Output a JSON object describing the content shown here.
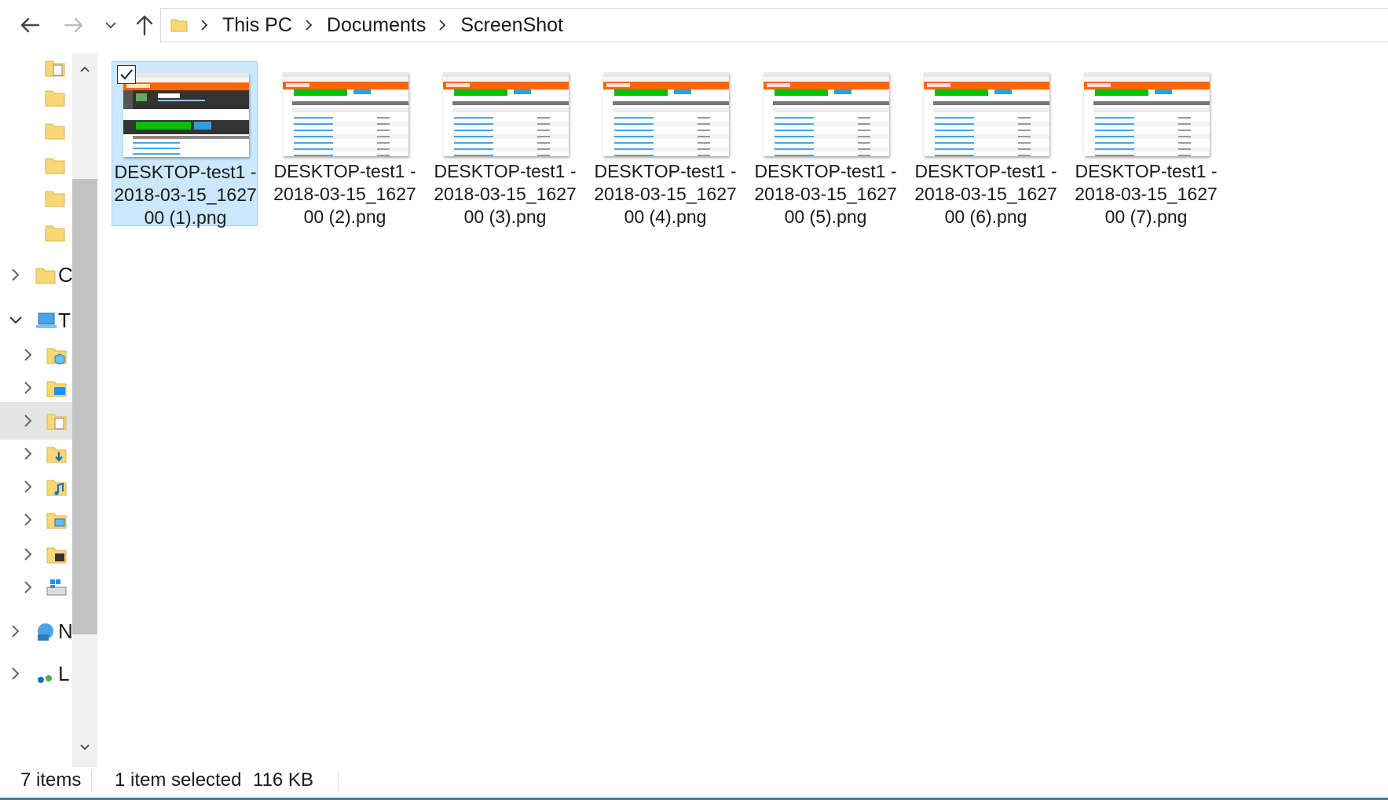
{
  "breadcrumb": [
    "This PC",
    "Documents",
    "ScreenShot"
  ],
  "nav_buttons": {
    "back": "arrow-left-icon",
    "forward": "arrow-right-icon",
    "recent": "chevron-down-icon",
    "up": "arrow-up-icon"
  },
  "nav_pane": {
    "items": [
      {
        "label": "",
        "icon": "folder-documents-icon"
      },
      {
        "label": "",
        "icon": "folder-pictures-icon"
      },
      {
        "label": "",
        "icon": "folder-icon"
      },
      {
        "label": "",
        "icon": "folder-icon"
      },
      {
        "label": "",
        "icon": "folder-icon"
      },
      {
        "label": "",
        "icon": "folder-icon"
      },
      {
        "label": "C",
        "icon": "folder-icon"
      },
      {
        "label": "T",
        "icon": "this-pc-icon"
      },
      {
        "label": "",
        "icon": "3d-objects-icon"
      },
      {
        "label": "",
        "icon": "desktop-folder-icon"
      },
      {
        "label": "",
        "icon": "documents-folder-icon"
      },
      {
        "label": "",
        "icon": "downloads-folder-icon"
      },
      {
        "label": "",
        "icon": "music-folder-icon"
      },
      {
        "label": "",
        "icon": "pictures-folder-icon"
      },
      {
        "label": "",
        "icon": "videos-folder-icon"
      },
      {
        "label": "",
        "icon": "windows-drive-icon"
      },
      {
        "label": "N",
        "icon": "network-icon"
      },
      {
        "label": "L",
        "icon": "homegroup-icon"
      }
    ]
  },
  "files": [
    {
      "name": "DESKTOP-test1 - 2018-03-15_162700 (1).png",
      "selected": true,
      "thumb_variant": "page"
    },
    {
      "name": "DESKTOP-test1 - 2018-03-15_162700 (2).png",
      "selected": false,
      "thumb_variant": "files"
    },
    {
      "name": "DESKTOP-test1 - 2018-03-15_162700 (3).png",
      "selected": false,
      "thumb_variant": "files"
    },
    {
      "name": "DESKTOP-test1 - 2018-03-15_162700 (4).png",
      "selected": false,
      "thumb_variant": "files"
    },
    {
      "name": "DESKTOP-test1 - 2018-03-15_162700 (5).png",
      "selected": false,
      "thumb_variant": "files"
    },
    {
      "name": "DESKTOP-test1 - 2018-03-15_162700 (6).png",
      "selected": false,
      "thumb_variant": "files"
    },
    {
      "name": "DESKTOP-test1 - 2018-03-15_162700 (7).png",
      "selected": false,
      "thumb_variant": "files"
    }
  ],
  "status": {
    "count": "7 items",
    "selection": "1 item selected",
    "size": "116 KB"
  },
  "colors": {
    "selection_bg": "#cce8ff",
    "selection_border": "#99d1ff",
    "folder_yellow": "#f8d775",
    "sourceforge_orange": "#ff6600",
    "download_green": "#00c000",
    "status_border": "#3b7ea1"
  }
}
